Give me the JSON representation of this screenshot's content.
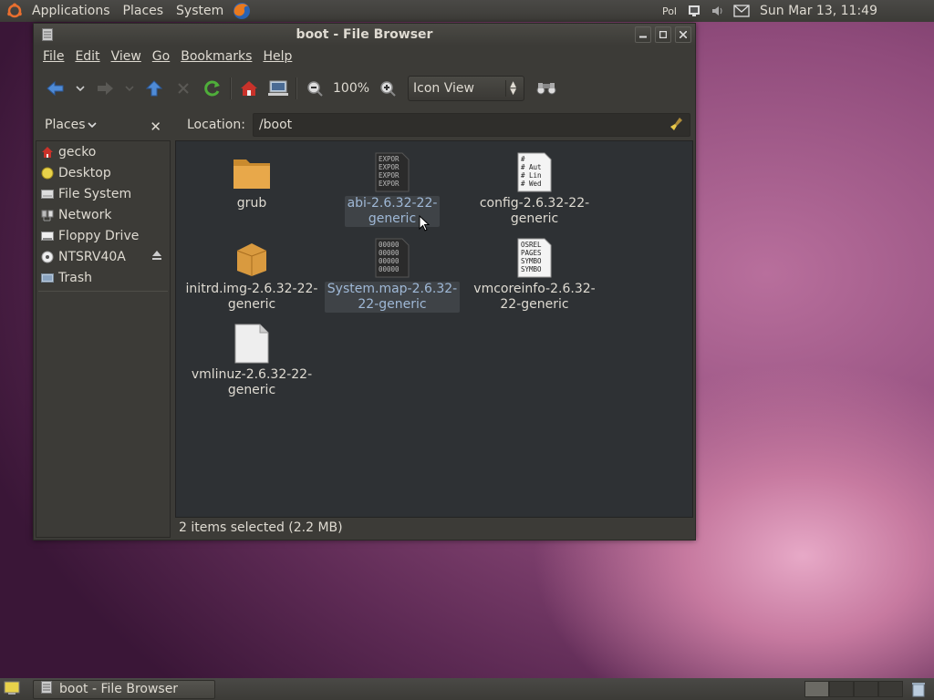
{
  "top_panel": {
    "menus": [
      "Applications",
      "Places",
      "System"
    ],
    "keyboard": "Pol",
    "clock": "Sun Mar 13, 11:49"
  },
  "window": {
    "title": "boot - File Browser",
    "menus": [
      "File",
      "Edit",
      "View",
      "Go",
      "Bookmarks",
      "Help"
    ],
    "zoom": "100%",
    "view_mode": "Icon View",
    "places_label": "Places",
    "location_label": "Location:",
    "location_value": "/boot",
    "status": "2 items selected (2.2 MB)"
  },
  "sidebar": {
    "items": [
      {
        "label": "gecko",
        "icon": "home-icon"
      },
      {
        "label": "Desktop",
        "icon": "desktop-icon"
      },
      {
        "label": "File System",
        "icon": "drive-icon"
      },
      {
        "label": "Network",
        "icon": "network-icon"
      },
      {
        "label": "Floppy Drive",
        "icon": "floppy-icon"
      },
      {
        "label": "NTSRV40A",
        "icon": "cdrom-icon"
      },
      {
        "label": "Trash",
        "icon": "trash-icon"
      }
    ]
  },
  "files": [
    {
      "name1": "grub",
      "name2": "",
      "type": "folder",
      "selected": false
    },
    {
      "name1": "abi-2.6.32-22-",
      "name2": "generic",
      "type": "text-dark",
      "selected": true,
      "preview": [
        "EXPOR",
        "EXPOR",
        "EXPOR",
        "EXPOR"
      ]
    },
    {
      "name1": "config-2.6.32-22-",
      "name2": "generic",
      "type": "text-light",
      "selected": false,
      "preview": [
        "#",
        "# Aut",
        "# Lin",
        "# Wed"
      ]
    },
    {
      "name1": "initrd.img-2.6.32-22-",
      "name2": "generic",
      "type": "package",
      "selected": false
    },
    {
      "name1": "System.map-2.6.32-",
      "name2": "22-generic",
      "type": "text-dark",
      "selected": true,
      "preview": [
        "00000",
        "00000",
        "00000",
        "00000"
      ]
    },
    {
      "name1": "vmcoreinfo-2.6.32-",
      "name2": "22-generic",
      "type": "text-light",
      "selected": false,
      "preview": [
        "OSREL",
        "PAGES",
        "SYMBO",
        "SYMBO"
      ]
    },
    {
      "name1": "vmlinuz-2.6.32-22-",
      "name2": "generic",
      "type": "blank",
      "selected": false
    }
  ],
  "taskbar": {
    "task_label": "boot - File Browser"
  },
  "colors": {
    "panel": "#3c3b37",
    "icon_area": "#2e3134",
    "selection_text": "#9fb8d6",
    "folder": "#e8a84a"
  }
}
